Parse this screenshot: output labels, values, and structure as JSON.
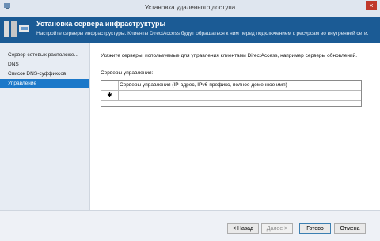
{
  "window": {
    "title": "Установка удаленного доступа",
    "close_glyph": "×"
  },
  "header": {
    "title": "Установка сервера инфраструктуры",
    "subtitle": "Настройте серверы инфраструктуры. Клиенты DirectAccess будут обращаться к ним перед подключением к ресурсам во внутренней сети."
  },
  "sidebar": {
    "items": [
      {
        "label": "Сервер сетевых расположе..."
      },
      {
        "label": "DNS"
      },
      {
        "label": "Список DNS-суффиксов"
      },
      {
        "label": "Управление"
      }
    ],
    "active_index": 3
  },
  "main": {
    "description": "Укажите серверы, используемые для управления клиентами DirectAccess, например серверы обновлений.",
    "grid_label": "Серверы управления:",
    "grid": {
      "column_header": "Серверы управления (IP-адрес, IPv6-префикс, полное доменное имя)",
      "new_row_marker": "✱"
    }
  },
  "buttons": {
    "back": "< Назад",
    "next": "Далее >",
    "finish": "Готово",
    "cancel": "Отмена"
  },
  "colors": {
    "header_bg": "#1b5b95",
    "selected_item": "#1b78c9",
    "close_button": "#c0392b"
  },
  "icons": {
    "window": "remote-access-icon",
    "header": "server-infrastructure-icon"
  }
}
